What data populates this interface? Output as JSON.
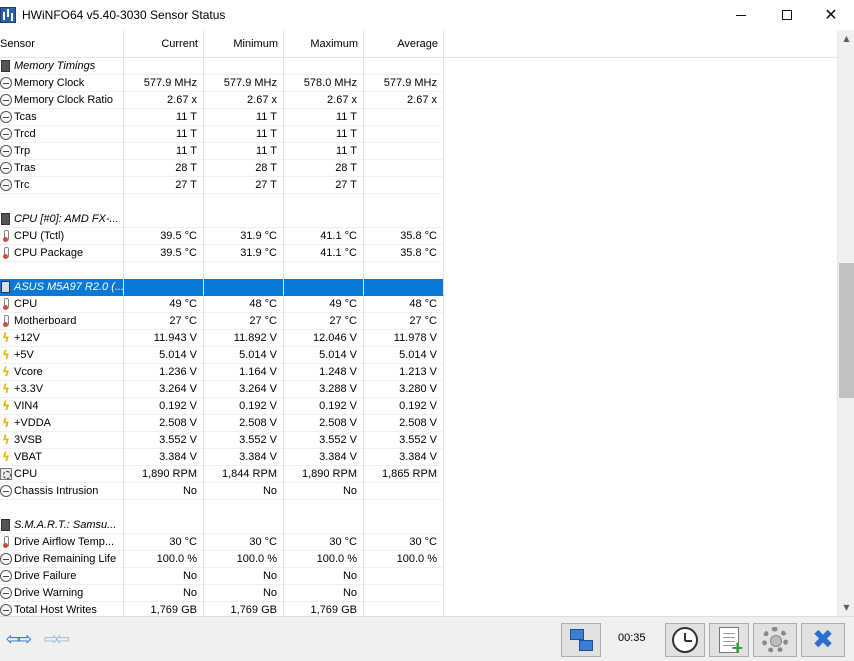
{
  "window": {
    "title": "HWiNFO64 v5.40-3030 Sensor Status"
  },
  "columns": [
    "Sensor",
    "Current",
    "Minimum",
    "Maximum",
    "Average"
  ],
  "rows": [
    {
      "kind": "section",
      "icon": "chip-icon",
      "name": "Memory Timings",
      "values": [
        "",
        "",
        "",
        ""
      ]
    },
    {
      "kind": "data",
      "icon": "clock-icon",
      "name": "Memory Clock",
      "values": [
        "577.9 MHz",
        "577.9 MHz",
        "578.0 MHz",
        "577.9 MHz"
      ]
    },
    {
      "kind": "data",
      "icon": "clock-icon",
      "name": "Memory Clock Ratio",
      "values": [
        "2.67 x",
        "2.67 x",
        "2.67 x",
        "2.67 x"
      ]
    },
    {
      "kind": "data",
      "icon": "clock-icon",
      "name": "Tcas",
      "values": [
        "11 T",
        "11 T",
        "11 T",
        ""
      ]
    },
    {
      "kind": "data",
      "icon": "clock-icon",
      "name": "Trcd",
      "values": [
        "11 T",
        "11 T",
        "11 T",
        ""
      ]
    },
    {
      "kind": "data",
      "icon": "clock-icon",
      "name": "Trp",
      "values": [
        "11 T",
        "11 T",
        "11 T",
        ""
      ]
    },
    {
      "kind": "data",
      "icon": "clock-icon",
      "name": "Tras",
      "values": [
        "28 T",
        "28 T",
        "28 T",
        ""
      ]
    },
    {
      "kind": "data",
      "icon": "clock-icon",
      "name": "Trc",
      "values": [
        "27 T",
        "27 T",
        "27 T",
        ""
      ]
    },
    {
      "kind": "blank",
      "icon": "",
      "name": "",
      "values": [
        "",
        "",
        "",
        ""
      ]
    },
    {
      "kind": "section",
      "icon": "chip-icon",
      "name": "CPU [#0]: AMD FX-...",
      "values": [
        "",
        "",
        "",
        ""
      ]
    },
    {
      "kind": "data",
      "icon": "thermometer-icon",
      "name": "CPU (Tctl)",
      "values": [
        "39.5 °C",
        "31.9 °C",
        "41.1 °C",
        "35.8 °C"
      ]
    },
    {
      "kind": "data",
      "icon": "thermometer-icon",
      "name": "CPU Package",
      "values": [
        "39.5 °C",
        "31.9 °C",
        "41.1 °C",
        "35.8 °C"
      ]
    },
    {
      "kind": "blank",
      "icon": "",
      "name": "",
      "values": [
        "",
        "",
        "",
        ""
      ]
    },
    {
      "kind": "section-selected",
      "icon": "chip-icon",
      "name": "ASUS M5A97 R2.0 (...",
      "values": [
        "",
        "",
        "",
        ""
      ]
    },
    {
      "kind": "data",
      "icon": "thermometer-icon",
      "name": "CPU",
      "values": [
        "49 °C",
        "48 °C",
        "49 °C",
        "48 °C"
      ]
    },
    {
      "kind": "data",
      "icon": "thermometer-icon",
      "name": "Motherboard",
      "values": [
        "27 °C",
        "27 °C",
        "27 °C",
        "27 °C"
      ]
    },
    {
      "kind": "data",
      "icon": "bolt-icon",
      "name": "+12V",
      "values": [
        "11.943 V",
        "11.892 V",
        "12.046 V",
        "11.978 V"
      ]
    },
    {
      "kind": "data",
      "icon": "bolt-icon",
      "name": "+5V",
      "values": [
        "5.014 V",
        "5.014 V",
        "5.014 V",
        "5.014 V"
      ]
    },
    {
      "kind": "data",
      "icon": "bolt-icon",
      "name": "Vcore",
      "values": [
        "1.236 V",
        "1.164 V",
        "1.248 V",
        "1.213 V"
      ]
    },
    {
      "kind": "data",
      "icon": "bolt-icon",
      "name": "+3.3V",
      "values": [
        "3.264 V",
        "3.264 V",
        "3.288 V",
        "3.280 V"
      ]
    },
    {
      "kind": "data",
      "icon": "bolt-icon",
      "name": "VIN4",
      "values": [
        "0.192 V",
        "0.192 V",
        "0.192 V",
        "0.192 V"
      ]
    },
    {
      "kind": "data",
      "icon": "bolt-icon",
      "name": "+VDDA",
      "values": [
        "2.508 V",
        "2.508 V",
        "2.508 V",
        "2.508 V"
      ]
    },
    {
      "kind": "data",
      "icon": "bolt-icon",
      "name": "3VSB",
      "values": [
        "3.552 V",
        "3.552 V",
        "3.552 V",
        "3.552 V"
      ]
    },
    {
      "kind": "data",
      "icon": "bolt-icon",
      "name": "VBAT",
      "values": [
        "3.384 V",
        "3.384 V",
        "3.384 V",
        "3.384 V"
      ]
    },
    {
      "kind": "data",
      "icon": "fan-icon",
      "name": "CPU",
      "values": [
        "1,890 RPM",
        "1,844 RPM",
        "1,890 RPM",
        "1,865 RPM"
      ]
    },
    {
      "kind": "data",
      "icon": "clock-icon",
      "name": "Chassis Intrusion",
      "values": [
        "No",
        "No",
        "No",
        ""
      ]
    },
    {
      "kind": "blank",
      "icon": "",
      "name": "",
      "values": [
        "",
        "",
        "",
        ""
      ]
    },
    {
      "kind": "section",
      "icon": "chip-icon",
      "name": "S.M.A.R.T.: Samsu...",
      "values": [
        "",
        "",
        "",
        ""
      ]
    },
    {
      "kind": "data",
      "icon": "thermometer-icon",
      "name": "Drive Airflow Temp...",
      "values": [
        "30 °C",
        "30 °C",
        "30 °C",
        "30 °C"
      ]
    },
    {
      "kind": "data",
      "icon": "clock-icon",
      "name": "Drive Remaining Life",
      "values": [
        "100.0 %",
        "100.0 %",
        "100.0 %",
        "100.0 %"
      ]
    },
    {
      "kind": "data",
      "icon": "clock-icon",
      "name": "Drive Failure",
      "values": [
        "No",
        "No",
        "No",
        ""
      ]
    },
    {
      "kind": "data",
      "icon": "clock-icon",
      "name": "Drive Warning",
      "values": [
        "No",
        "No",
        "No",
        ""
      ]
    },
    {
      "kind": "data",
      "icon": "clock-icon",
      "name": "Total Host Writes",
      "values": [
        "1,769 GB",
        "1,769 GB",
        "1,769 GB",
        ""
      ]
    }
  ],
  "toolbar": {
    "timer": "00:35",
    "buttons": [
      "network-icon",
      "clock-icon",
      "log-add-icon",
      "gear-icon",
      "close-icon"
    ]
  }
}
